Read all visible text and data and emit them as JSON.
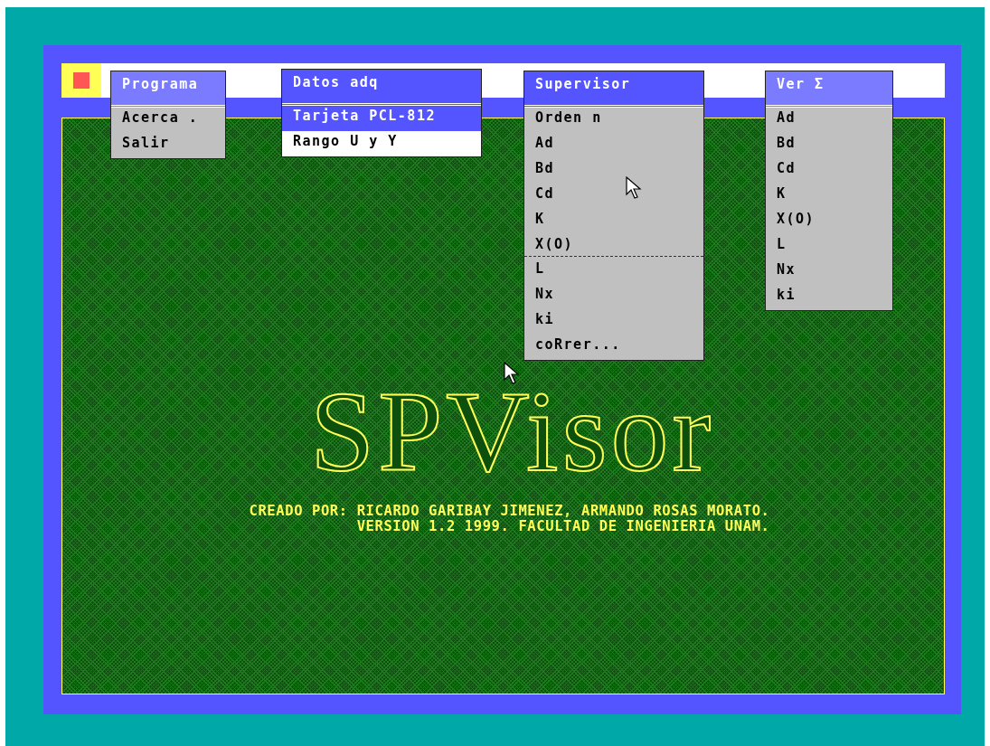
{
  "menus": [
    {
      "title": "Programa",
      "active": true,
      "items": [
        {
          "label": "Acerca .",
          "selected": false
        },
        {
          "label": "Salir",
          "selected": false
        }
      ]
    },
    {
      "title": "Datos adq",
      "active": false,
      "items": [
        {
          "label": "Tarjeta PCL-812",
          "selected": true
        },
        {
          "label": "Rango U y Y",
          "selected": false
        }
      ]
    },
    {
      "title": "Supervisor",
      "active": false,
      "items": [
        {
          "label": "Orden n",
          "selected": false
        },
        {
          "label": "Ad",
          "selected": false
        },
        {
          "label": "Bd",
          "selected": false
        },
        {
          "label": "Cd",
          "selected": false
        },
        {
          "label": "K",
          "selected": false
        },
        {
          "label": "X(O)",
          "selected": false
        },
        {
          "label": "L",
          "selected": false
        },
        {
          "label": "Nx",
          "selected": false
        },
        {
          "label": "ki",
          "selected": false
        },
        {
          "label": "coRrer...",
          "selected": false
        }
      ]
    },
    {
      "title": "Ver Σ",
      "active": true,
      "items": [
        {
          "label": "Ad",
          "selected": false
        },
        {
          "label": "Bd",
          "selected": false
        },
        {
          "label": "Cd",
          "selected": false
        },
        {
          "label": "K",
          "selected": false
        },
        {
          "label": "X(O)",
          "selected": false
        },
        {
          "label": "L",
          "selected": false
        },
        {
          "label": "Nx",
          "selected": false
        },
        {
          "label": "ki",
          "selected": false
        }
      ]
    }
  ],
  "logo": "SPVisor",
  "credits": [
    "CREADO POR: RICARDO GARIBAY JIMENEZ, ARMANDO ROSAS MORATO.",
    "VERSION 1.2 1999. FACULTAD DE INGENIERIA UNAM."
  ]
}
